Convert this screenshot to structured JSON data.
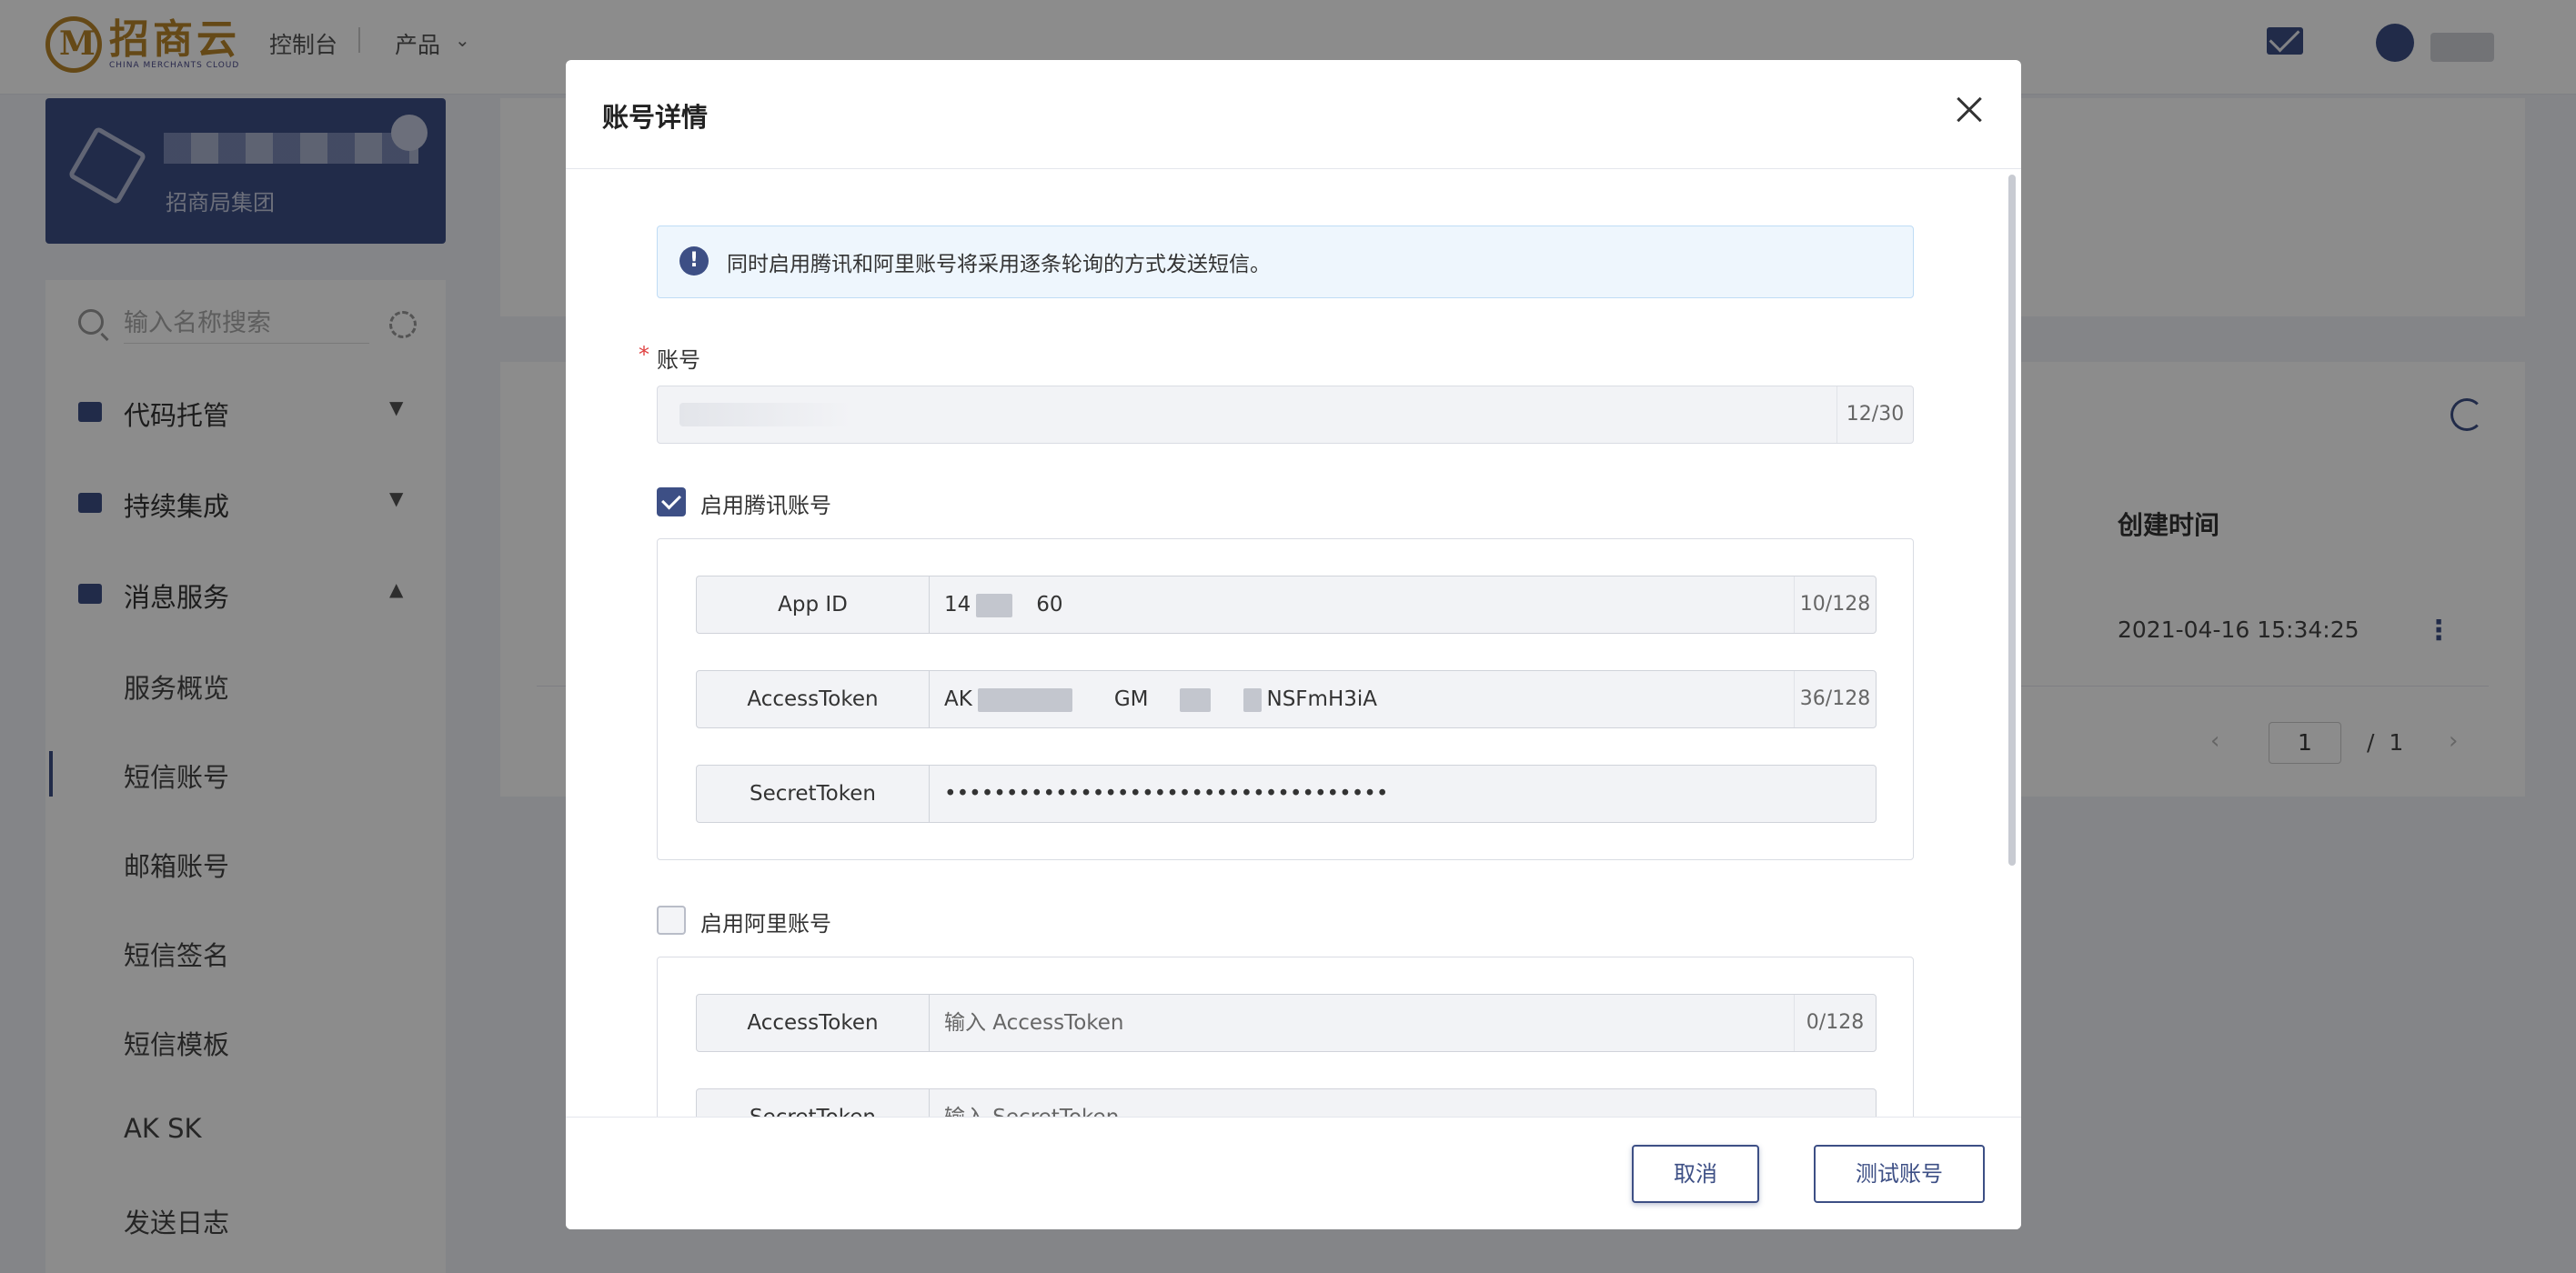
{
  "background": {
    "brand": {
      "name": "招商云",
      "sub": "CHINA MERCHANTS CLOUD"
    },
    "nav": {
      "console": "控制台",
      "product": "产品"
    },
    "org_name": "招商局集团",
    "search_placeholder": "输入名称搜索",
    "menu": {
      "groups": [
        {
          "label": "代码托管",
          "icon": "code-icon",
          "expanded": false
        },
        {
          "label": "持续集成",
          "icon": "ci-icon",
          "expanded": false
        },
        {
          "label": "消息服务",
          "icon": "message-icon",
          "expanded": true
        }
      ],
      "sub_items": [
        "服务概览",
        "短信账号",
        "邮箱账号",
        "短信签名",
        "短信模板",
        "AK SK",
        "发送日志"
      ],
      "active_sub_item": "短信账号"
    },
    "table": {
      "column_created": "创建时间",
      "rows": [
        {
          "created": "2021-04-16 15:34:25"
        }
      ]
    },
    "pagination": {
      "current": "1",
      "separator": "/",
      "total": "1"
    }
  },
  "modal": {
    "title": "账号详情",
    "alert": "同时启用腾讯和阿里账号将采用逐条轮询的方式发送短信。",
    "account": {
      "label": "账号",
      "required": true,
      "count": "12/30"
    },
    "tencent": {
      "checkbox_label": "启用腾讯账号",
      "checked": true,
      "fields": {
        "app_id": {
          "key": "App ID",
          "prefix": "14",
          "suffix": "60",
          "count": "10/128"
        },
        "access_token": {
          "key": "AccessToken",
          "part1": "AK",
          "part2": "GM",
          "part3": "NSFmH3iA",
          "count": "36/128"
        },
        "secret_token": {
          "key": "SecretToken",
          "masked": "••••••••••••••••••••••••••••••••••••"
        }
      }
    },
    "ali": {
      "checkbox_label": "启用阿里账号",
      "checked": false,
      "fields": {
        "access_token": {
          "key": "AccessToken",
          "placeholder": "输入 AccessToken",
          "count": "0/128"
        },
        "secret_token": {
          "key": "SecretToken",
          "placeholder": "输入 SecretToken"
        }
      }
    },
    "buttons": {
      "cancel": "取消",
      "test": "测试账号"
    }
  },
  "colors": {
    "accent": "#3d4f85",
    "required": "#e04040",
    "alert_bg": "#eef6fd"
  }
}
